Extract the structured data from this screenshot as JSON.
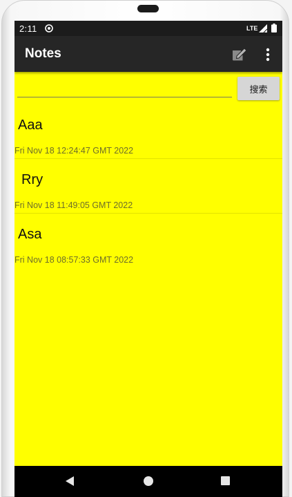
{
  "status_bar": {
    "time": "2:11",
    "network": "LTE"
  },
  "app_bar": {
    "title": "Notes",
    "icons": [
      "compose-icon",
      "more-vert-icon"
    ]
  },
  "search": {
    "value": "",
    "placeholder": "",
    "button_label": "搜索"
  },
  "notes": [
    {
      "title": "Aaa",
      "date": "Fri Nov 18 12:24:47 GMT 2022"
    },
    {
      "title": "Rry",
      "date": "Fri Nov 18 11:49:05 GMT 2022"
    },
    {
      "title": "Asa",
      "date": "Fri Nov 18 08:57:33 GMT 2022"
    }
  ],
  "colors": {
    "background": "#ffff00",
    "app_bar": "#262626",
    "status_bar": "#1c1c1c",
    "nav_bar": "#000000"
  },
  "nav_bar": {
    "icons": [
      "back-icon",
      "home-icon",
      "recents-icon"
    ]
  }
}
